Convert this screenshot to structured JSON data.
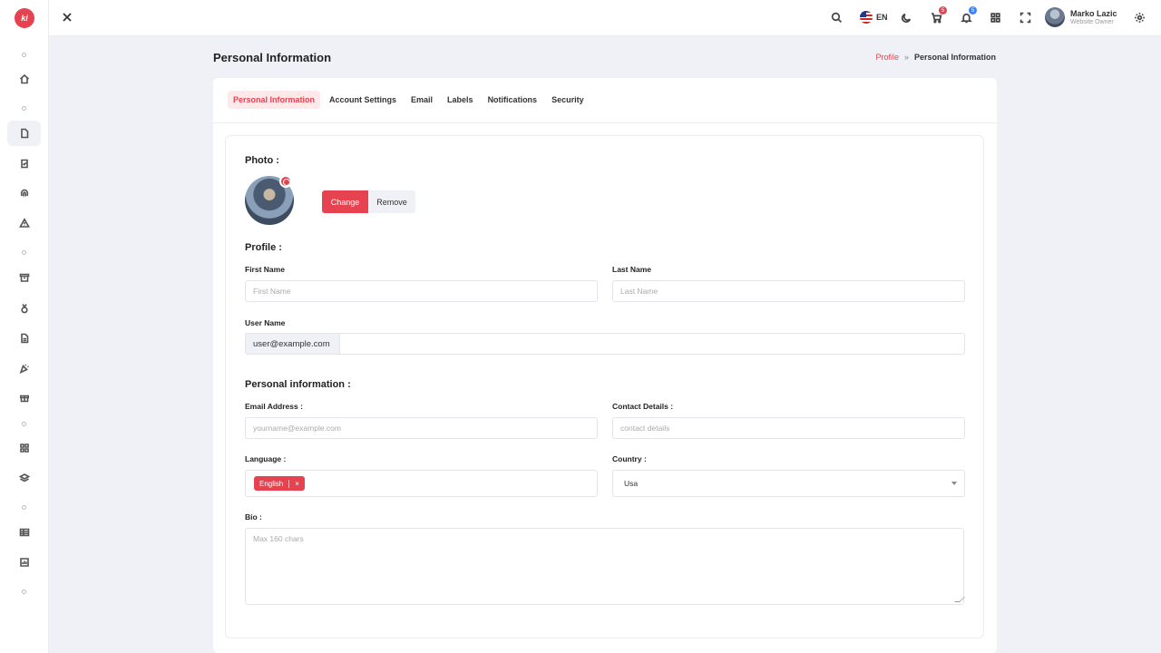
{
  "app": {
    "logo_text": "ki"
  },
  "header": {
    "language": "EN",
    "cart_count": "5",
    "notification_count": "5",
    "user_name": "Marko Lazic",
    "user_role": "Website Owner"
  },
  "page": {
    "title": "Personal Information"
  },
  "breadcrumb": {
    "parent": "Profile",
    "separator": "»",
    "current": "Personal Information"
  },
  "tabs": [
    {
      "label": "Personal Information",
      "active": true
    },
    {
      "label": "Account Settings"
    },
    {
      "label": "Email"
    },
    {
      "label": "Labels"
    },
    {
      "label": "Notifications"
    },
    {
      "label": "Security"
    }
  ],
  "form": {
    "photo_title": "Photo :",
    "change_label": "Change",
    "remove_label": "Remove",
    "profile_title": "Profile :",
    "first_name_label": "First Name",
    "first_name_placeholder": "First Name",
    "last_name_label": "Last Name",
    "last_name_placeholder": "Last Name",
    "username_label": "User Name",
    "username_addon": "user@example.com",
    "personal_title": "Personal information :",
    "email_label": "Email Address :",
    "email_placeholder": "yourname@example.com",
    "contact_label": "Contact Details :",
    "contact_placeholder": "contact details",
    "language_label": "Language :",
    "language_chip": "English",
    "language_chip_remove": "×",
    "country_label": "Country :",
    "country_value": "Usa",
    "bio_label": "Bio :",
    "bio_placeholder": "Max 160 chars"
  }
}
